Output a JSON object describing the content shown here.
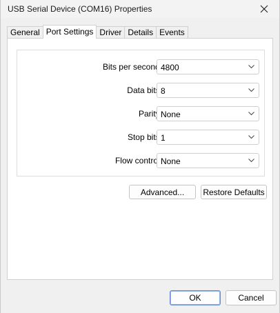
{
  "window": {
    "title": "USB Serial Device (COM16) Properties"
  },
  "tabs": [
    {
      "label": "General",
      "active": false
    },
    {
      "label": "Port Settings",
      "active": true
    },
    {
      "label": "Driver",
      "active": false
    },
    {
      "label": "Details",
      "active": false
    },
    {
      "label": "Events",
      "active": false
    }
  ],
  "port_settings": {
    "fields": [
      {
        "label": "Bits per second:",
        "value": "4800"
      },
      {
        "label": "Data bits:",
        "value": "8"
      },
      {
        "label": "Parity:",
        "value": "None"
      },
      {
        "label": "Stop bits:",
        "value": "1"
      },
      {
        "label": "Flow control:",
        "value": "None"
      }
    ],
    "advanced_label": "Advanced...",
    "restore_defaults_label": "Restore Defaults"
  },
  "footer": {
    "ok_label": "OK",
    "cancel_label": "Cancel"
  },
  "icons": {
    "close": "close-icon",
    "dropdown": "chevron-down-icon"
  },
  "colors": {
    "default_button_border": "#6b8bd0"
  }
}
